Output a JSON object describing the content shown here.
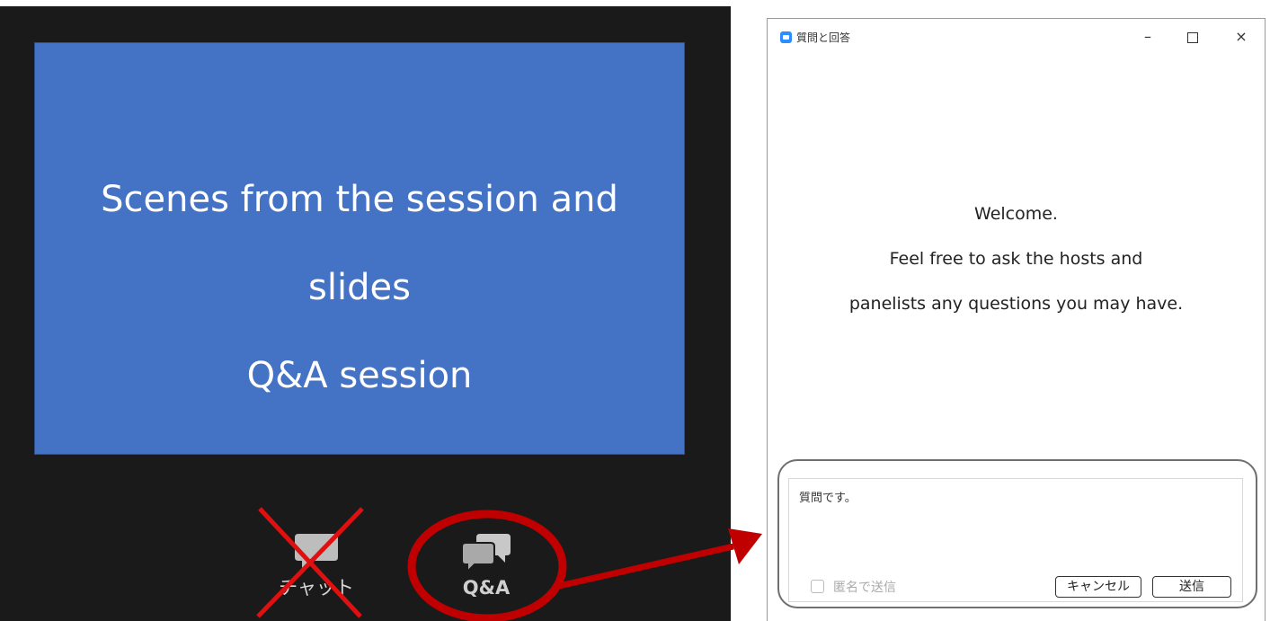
{
  "slide": {
    "line1": "Scenes from the session and",
    "line2": "slides",
    "line3": "Q&A session",
    "bg_color": "#4472c4"
  },
  "toolbar": {
    "chat_label": "チャット",
    "chat_icon": "chat-bubble-icon",
    "qa_label": "Q&A",
    "qa_icon": "qa-bubbles-icon"
  },
  "annotations": {
    "cross_color": "#e01010",
    "highlight_color": "#c00000"
  },
  "qa_window": {
    "title": "質問と回答",
    "welcome_line1": "Welcome.",
    "welcome_line2": "Feel free to ask the hosts and",
    "welcome_line3": "panelists any questions you may have.",
    "input_value": "質問です。",
    "anonymous_label": "匿名で送信",
    "cancel_label": "キャンセル",
    "send_label": "送信",
    "minimize_glyph": "–",
    "close_glyph": "×"
  }
}
